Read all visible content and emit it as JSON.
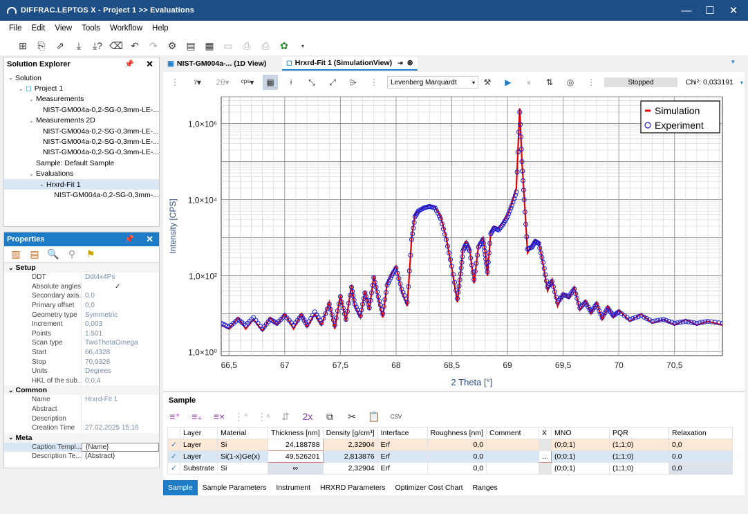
{
  "window": {
    "title": "DIFFRAC.LEPTOS X - Project 1 >> Evaluations",
    "min": "—",
    "max": "☐",
    "close": "✕"
  },
  "menu": [
    "File",
    "Edit",
    "View",
    "Tools",
    "Workflow",
    "Help"
  ],
  "toolbar_icons": [
    "new-icon",
    "import-icon",
    "export-icon",
    "download-icon",
    "download-query-icon",
    "eraser-icon",
    "undo-icon",
    "redo-icon",
    "settings-icon",
    "database-icon",
    "database-list-icon",
    "print-preview-icon",
    "print-icon",
    "print-setup-icon",
    "plugin-icon",
    "dropdown-icon"
  ],
  "solution_explorer": {
    "title": "Solution Explorer",
    "pin": "📌",
    "close": "✕",
    "items": [
      {
        "label": "Solution",
        "indent": 0,
        "arrow": "v"
      },
      {
        "label": "Project 1",
        "indent": 1,
        "arrow": "v",
        "icon": true
      },
      {
        "label": "Measurements",
        "indent": 2,
        "arrow": "v"
      },
      {
        "label": "NIST-GM004a-0,2-SG-0,3mm-LE-...",
        "indent": 3,
        "arrow": ""
      },
      {
        "label": "Measurements 2D",
        "indent": 2,
        "arrow": "v"
      },
      {
        "label": "NIST-GM004a-0,2-SG-0,3mm-LE-...",
        "indent": 3,
        "arrow": ""
      },
      {
        "label": "NIST-GM004a-0,2-SG-0,3mm-LE-...",
        "indent": 3,
        "arrow": ""
      },
      {
        "label": "NIST-GM004a-0,2-SG-0,3mm-LE-...",
        "indent": 3,
        "arrow": ""
      },
      {
        "label": "Sample: Default Sample",
        "indent": 2,
        "arrow": ""
      },
      {
        "label": "Evaluations",
        "indent": 2,
        "arrow": "v"
      },
      {
        "label": "Hrxrd-Fit 1",
        "indent": 3,
        "arrow": "v",
        "selected": true
      },
      {
        "label": "NIST-GM004a-0,2-SG-0,3mm-...",
        "indent": 4,
        "arrow": ""
      }
    ]
  },
  "properties": {
    "title": "Properties",
    "pin": "📌",
    "close": "✕",
    "sections": [
      {
        "name": "Setup",
        "rows": [
          {
            "k": "DDT",
            "v": "Ddt4x4Ps"
          },
          {
            "k": "Absolute angles",
            "v": "✓"
          },
          {
            "k": "Secondary axis...",
            "v": "0,0"
          },
          {
            "k": "Primary offset",
            "v": "0,0"
          },
          {
            "k": "Geometry type",
            "v": "Symmetric"
          },
          {
            "k": "Increment",
            "v": "0,003"
          },
          {
            "k": "Points",
            "v": "1.501"
          },
          {
            "k": "Scan type",
            "v": "TwoThetaOmega"
          },
          {
            "k": "Start",
            "v": "66,4328"
          },
          {
            "k": "Stop",
            "v": "70,9328"
          },
          {
            "k": "Units",
            "v": "Degrees"
          },
          {
            "k": "HKL of the sub...",
            "v": "0;0;4"
          }
        ]
      },
      {
        "name": "Common",
        "rows": [
          {
            "k": "Name",
            "v": "Hrxrd-Fit 1"
          },
          {
            "k": "Abstract",
            "v": ""
          },
          {
            "k": "Description",
            "v": ""
          },
          {
            "k": "Creation Time",
            "v": "27.02.2025 15:16"
          }
        ]
      },
      {
        "name": "Meta",
        "rows": [
          {
            "k": "Caption Templ...",
            "v": "{Name}"
          },
          {
            "k": "Description Te...",
            "v": "{Abstract}"
          }
        ]
      }
    ]
  },
  "tabs": [
    {
      "label": "NIST-GM004a-... (1D View)"
    },
    {
      "label": "Hrxrd-Fit 1 (SimulationView)"
    }
  ],
  "fitbar": {
    "optimizer": "Levenberg Marquardt",
    "status": "Stopped",
    "chi2": "Chi²: 0,033191"
  },
  "chart_data": {
    "type": "line",
    "xlabel": "2 Theta [°]",
    "ylabel": "Intensity [CPS]",
    "xlim": [
      66.43,
      70.93
    ],
    "ylim_log10": [
      -0.1,
      6.7
    ],
    "x_ticks": [
      "66,5",
      "67",
      "67,5",
      "68",
      "68,5",
      "69",
      "69,5",
      "70",
      "70,5"
    ],
    "y_ticks": [
      "1,0×10⁰",
      "1,0×10²",
      "1,0×10⁴",
      "1,0×10⁶"
    ],
    "legend": {
      "position": "top-right",
      "items": [
        "Simulation",
        "Experiment"
      ]
    },
    "scale": "log",
    "grid": true,
    "series": [
      {
        "name": "Simulation",
        "color": "#e00000",
        "kind": "line",
        "x": [
          66.43,
          66.5,
          66.58,
          66.65,
          66.72,
          66.8,
          66.87,
          66.93,
          67.0,
          67.08,
          67.15,
          67.2,
          67.27,
          67.33,
          67.4,
          67.45,
          67.5,
          67.55,
          67.6,
          67.63,
          67.68,
          67.72,
          67.76,
          67.8,
          67.84,
          67.88,
          67.92,
          67.96,
          68.0,
          68.05,
          68.1,
          68.14,
          68.17,
          68.2,
          68.25,
          68.3,
          68.35,
          68.4,
          68.45,
          68.5,
          68.55,
          68.58,
          68.6,
          68.63,
          68.66,
          68.7,
          68.74,
          68.78,
          68.8,
          68.82,
          68.85,
          68.88,
          68.92,
          68.96,
          69.0,
          69.04,
          69.08,
          69.11,
          69.13,
          69.15,
          69.18,
          69.22,
          69.25,
          69.28,
          69.32,
          69.36,
          69.4,
          69.45,
          69.5,
          69.55,
          69.6,
          69.65,
          69.7,
          69.75,
          69.8,
          69.85,
          69.9,
          69.95,
          70.0,
          70.1,
          70.2,
          70.3,
          70.4,
          70.5,
          70.6,
          70.7,
          70.8,
          70.93
        ],
        "y": [
          0.7,
          0.6,
          0.9,
          0.6,
          0.85,
          0.55,
          0.9,
          0.7,
          1.0,
          0.6,
          1.0,
          0.65,
          1.0,
          0.7,
          1.3,
          0.6,
          1.5,
          0.8,
          1.75,
          1.2,
          0.9,
          1.6,
          1.1,
          2.0,
          1.4,
          0.9,
          1.8,
          2.05,
          2.25,
          1.6,
          1.2,
          3.0,
          3.6,
          3.7,
          3.8,
          3.85,
          3.8,
          3.55,
          3.0,
          2.2,
          1.3,
          2.1,
          2.7,
          2.9,
          2.7,
          1.8,
          2.8,
          3.0,
          2.6,
          2.0,
          3.15,
          3.3,
          3.25,
          3.4,
          3.6,
          3.9,
          4.3,
          6.4,
          5.0,
          4.1,
          2.6,
          2.8,
          2.95,
          2.9,
          2.3,
          1.6,
          1.9,
          1.2,
          1.55,
          1.4,
          1.7,
          1.1,
          1.35,
          1.0,
          1.3,
          0.85,
          1.2,
          0.9,
          1.1,
          0.8,
          1.0,
          0.75,
          0.85,
          0.7,
          0.85,
          0.7,
          0.8,
          0.7
        ]
      },
      {
        "name": "Experiment",
        "color": "#1a1ad0",
        "kind": "markers",
        "x": [
          66.43,
          66.5,
          66.58,
          66.65,
          66.72,
          66.8,
          66.87,
          66.93,
          67.0,
          67.08,
          67.15,
          67.2,
          67.27,
          67.33,
          67.4,
          67.45,
          67.5,
          67.55,
          67.6,
          67.63,
          67.68,
          67.72,
          67.76,
          67.8,
          67.84,
          67.88,
          67.92,
          67.96,
          68.0,
          68.05,
          68.1,
          68.14,
          68.17,
          68.2,
          68.25,
          68.3,
          68.35,
          68.4,
          68.45,
          68.5,
          68.55,
          68.58,
          68.6,
          68.63,
          68.66,
          68.7,
          68.74,
          68.78,
          68.8,
          68.82,
          68.85,
          68.88,
          68.92,
          68.96,
          69.0,
          69.04,
          69.08,
          69.11,
          69.13,
          69.15,
          69.18,
          69.22,
          69.25,
          69.28,
          69.32,
          69.36,
          69.4,
          69.45,
          69.5,
          69.55,
          69.6,
          69.65,
          69.7,
          69.75,
          69.8,
          69.85,
          69.9,
          69.95,
          70.0,
          70.1,
          70.2,
          70.3,
          70.4,
          70.5,
          70.6,
          70.7,
          70.8,
          70.93
        ],
        "y": [
          0.75,
          0.65,
          0.85,
          0.7,
          0.9,
          0.6,
          0.85,
          0.75,
          0.95,
          0.7,
          0.95,
          0.7,
          1.05,
          0.75,
          1.25,
          0.7,
          1.45,
          0.85,
          1.7,
          1.25,
          0.95,
          1.55,
          1.15,
          1.95,
          1.45,
          1.0,
          1.75,
          2.0,
          2.2,
          1.65,
          1.3,
          2.95,
          3.55,
          3.7,
          3.78,
          3.82,
          3.78,
          3.5,
          2.95,
          2.25,
          1.4,
          2.05,
          2.65,
          2.85,
          2.65,
          1.9,
          2.75,
          2.95,
          2.55,
          2.1,
          3.1,
          3.25,
          3.2,
          3.35,
          3.55,
          3.85,
          4.2,
          6.3,
          5.0,
          4.0,
          2.7,
          2.75,
          2.9,
          2.85,
          2.35,
          1.7,
          1.85,
          1.3,
          1.5,
          1.45,
          1.65,
          1.15,
          1.3,
          1.05,
          1.25,
          0.9,
          1.15,
          0.95,
          1.05,
          0.85,
          0.95,
          0.8,
          0.85,
          0.75,
          0.8,
          0.75,
          0.8,
          0.75
        ]
      }
    ]
  },
  "sample": {
    "title": "Sample",
    "columns": [
      "",
      "Layer",
      "Material",
      "Thickness [nm]",
      "Density [g/cm³]",
      "Interface",
      "Roughness [nm]",
      "Comment",
      "X",
      "MNO",
      "PQR",
      "Relaxation"
    ],
    "rows": [
      {
        "check": "✓",
        "layer": "Layer",
        "material": "Si",
        "thickness": "24,188788",
        "density": "2,32904",
        "interface": "Erf",
        "roughness": "0,0",
        "comment": "",
        "x": "",
        "mno": "(0;0;1)",
        "pqr": "(1;1;0)",
        "relax": "0,0"
      },
      {
        "check": "✓",
        "layer": "Layer",
        "material": "Si(1-x)Ge(x)",
        "thickness": "49,526201",
        "density": "2,813876",
        "interface": "Erf",
        "roughness": "0,0",
        "comment": "",
        "x": "...",
        "mno": "(0;0;1)",
        "pqr": "(1;1;0)",
        "relax": "0,0"
      },
      {
        "check": "✓",
        "layer": "Substrate",
        "material": "Si",
        "thickness": "∞",
        "density": "2,32904",
        "interface": "Erf",
        "roughness": "0,0",
        "comment": "",
        "x": "",
        "mno": "(0;0;1)",
        "pqr": "(1;1;0)",
        "relax": "0,0"
      }
    ]
  },
  "bottom_tabs": [
    "Sample",
    "Sample Parameters",
    "Instrument",
    "HRXRD Parameters",
    "Optimizer Cost Chart",
    "Ranges"
  ]
}
